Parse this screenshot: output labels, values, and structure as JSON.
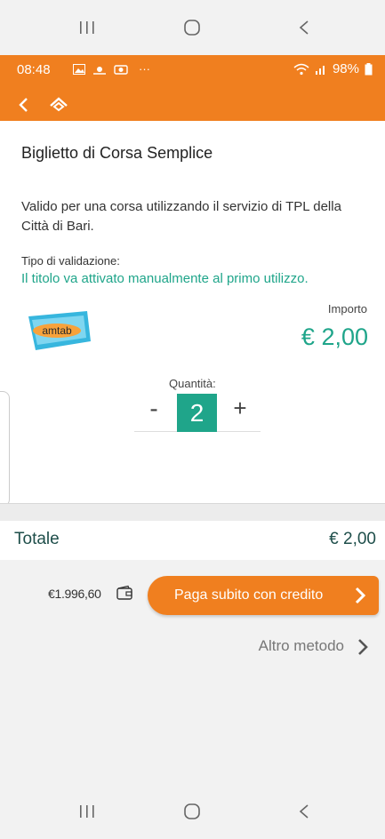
{
  "system_nav": {
    "recent_icon": "recent-apps-icon",
    "home_icon": "home-circle-icon",
    "back_icon": "back-chevron-icon"
  },
  "status_bar": {
    "time": "08:48",
    "more": "···",
    "battery": "98%"
  },
  "header": {
    "back_icon": "back-arrow-icon",
    "home_icon": "home-icon",
    "color": "#f07f1f"
  },
  "ticket": {
    "title": "Biglietto di Corsa Semplice",
    "description": "Valido per una corsa utilizzando il servizio di TPL della Città di Bari.",
    "validation_label": "Tipo di validazione:",
    "validation_text": "Il titolo va attivato manualmente al primo utilizzo.",
    "logo_text": "amtab",
    "importo_label": "Importo",
    "importo_value": "€ 2,00"
  },
  "quantity": {
    "label": "Quantità:",
    "minus": "-",
    "value": "2",
    "plus": "+"
  },
  "total": {
    "label": "Totale",
    "value": "€ 2,00"
  },
  "payment": {
    "credit_balance": "€1.996,60",
    "pay_button_label": "Paga subito con credito",
    "other_method_label": "Altro metodo"
  },
  "colors": {
    "accent_orange": "#f07f1f",
    "accent_green": "#1fa58a",
    "total_text": "#1e4e4a"
  }
}
